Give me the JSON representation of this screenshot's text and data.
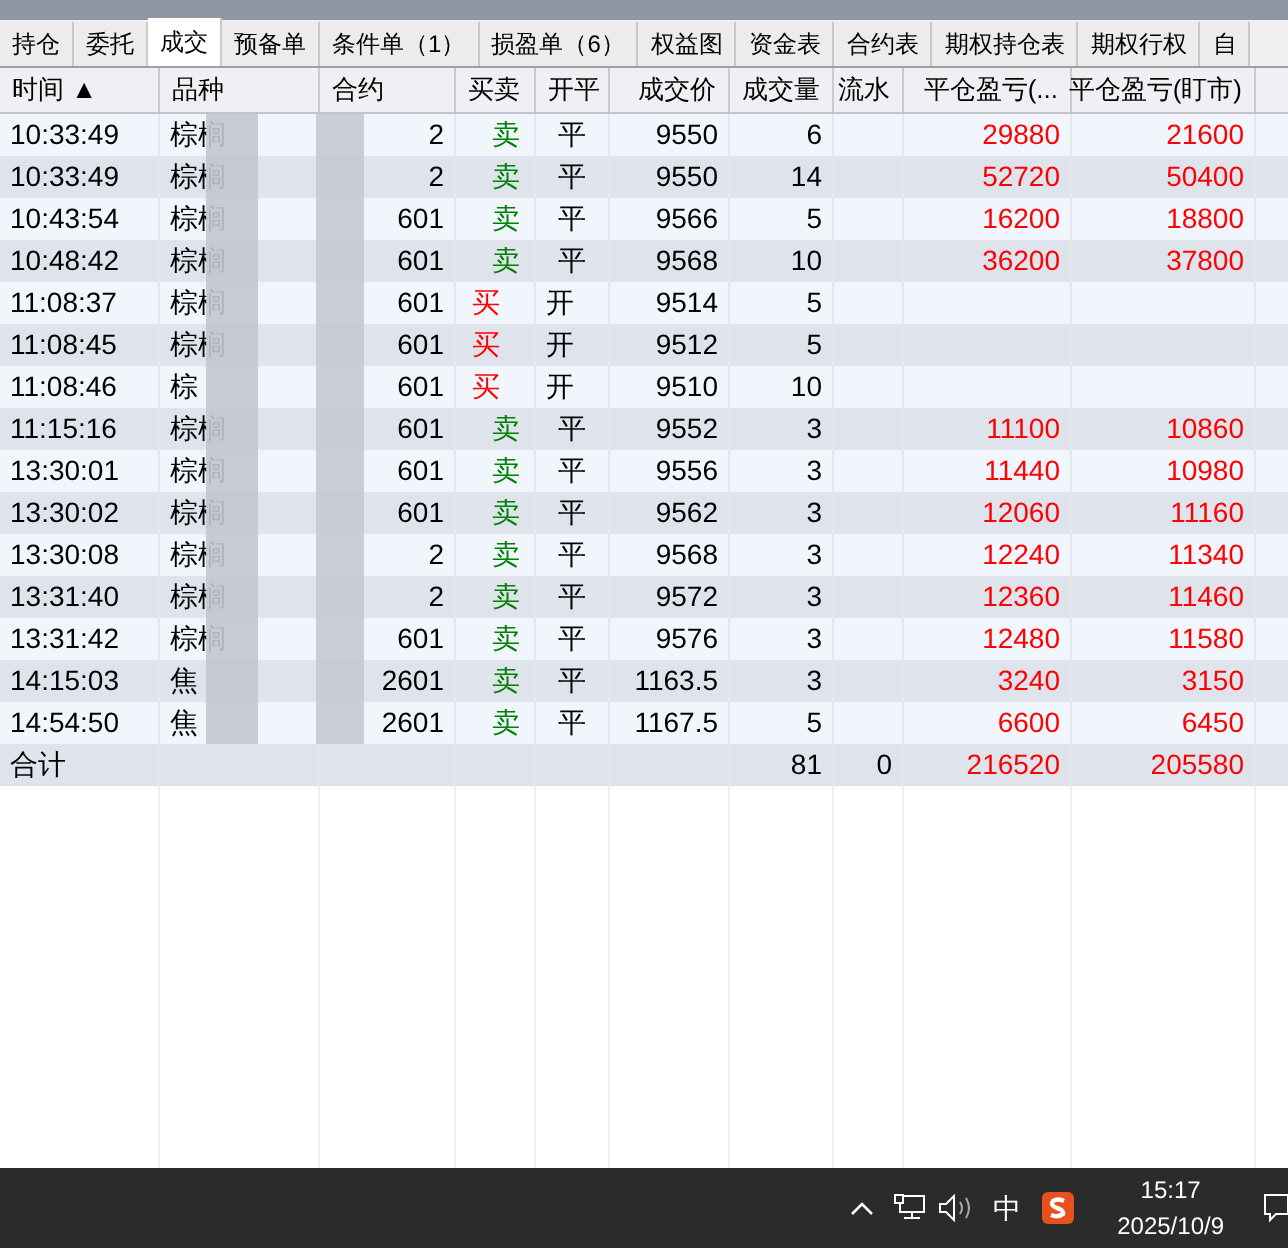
{
  "tabs": [
    {
      "label": "持仓",
      "selected": false
    },
    {
      "label": "委托",
      "selected": false
    },
    {
      "label": "成交",
      "selected": true
    },
    {
      "label": "预备单",
      "selected": false
    },
    {
      "label": "条件单（1）",
      "selected": false
    },
    {
      "label": "损盈单（6）",
      "selected": false
    },
    {
      "label": "权益图",
      "selected": false
    },
    {
      "label": "资金表",
      "selected": false
    },
    {
      "label": "合约表",
      "selected": false
    },
    {
      "label": "期权持仓表",
      "selected": false
    },
    {
      "label": "期权行权",
      "selected": false
    },
    {
      "label": "自",
      "selected": false
    }
  ],
  "table": {
    "columns": [
      "时间 ▲",
      "品种",
      "合约",
      "买卖",
      "开平",
      "成交价",
      "成交量",
      "流水",
      "平仓盈亏(...",
      "平仓盈亏(盯市)"
    ],
    "rows": [
      {
        "time": "10:33:49",
        "product": "棕榈",
        "contract": "2",
        "side": {
          "text": "卖",
          "kind": "sell"
        },
        "open_close": "平",
        "price": "9550",
        "qty": "6",
        "pnl_close": "29880",
        "pnl_mtm": "21600"
      },
      {
        "time": "10:33:49",
        "product": "棕榈",
        "contract": "2",
        "side": {
          "text": "卖",
          "kind": "sell"
        },
        "open_close": "平",
        "price": "9550",
        "qty": "14",
        "pnl_close": "52720",
        "pnl_mtm": "50400"
      },
      {
        "time": "10:43:54",
        "product": "棕榈",
        "contract": "601",
        "side": {
          "text": "卖",
          "kind": "sell"
        },
        "open_close": "平",
        "price": "9566",
        "qty": "5",
        "pnl_close": "16200",
        "pnl_mtm": "18800"
      },
      {
        "time": "10:48:42",
        "product": "棕榈",
        "contract": "601",
        "side": {
          "text": "卖",
          "kind": "sell"
        },
        "open_close": "平",
        "price": "9568",
        "qty": "10",
        "pnl_close": "36200",
        "pnl_mtm": "37800"
      },
      {
        "time": "11:08:37",
        "product": "棕榈",
        "contract": "601",
        "side": {
          "text": "买",
          "kind": "buy"
        },
        "open_close": "开",
        "price": "9514",
        "qty": "5"
      },
      {
        "time": "11:08:45",
        "product": "棕榈",
        "contract": "601",
        "side": {
          "text": "买",
          "kind": "buy"
        },
        "open_close": "开",
        "price": "9512",
        "qty": "5"
      },
      {
        "time": "11:08:46",
        "product": "棕",
        "contract": "601",
        "side": {
          "text": "买",
          "kind": "buy"
        },
        "open_close": "开",
        "price": "9510",
        "qty": "10"
      },
      {
        "time": "11:15:16",
        "product": "棕榈",
        "contract": "601",
        "side": {
          "text": "卖",
          "kind": "sell"
        },
        "open_close": "平",
        "price": "9552",
        "qty": "3",
        "pnl_close": "11100",
        "pnl_mtm": "10860"
      },
      {
        "time": "13:30:01",
        "product": "棕榈",
        "contract": "601",
        "side": {
          "text": "卖",
          "kind": "sell"
        },
        "open_close": "平",
        "price": "9556",
        "qty": "3",
        "pnl_close": "11440",
        "pnl_mtm": "10980"
      },
      {
        "time": "13:30:02",
        "product": "棕榈",
        "contract": "601",
        "side": {
          "text": "卖",
          "kind": "sell"
        },
        "open_close": "平",
        "price": "9562",
        "qty": "3",
        "pnl_close": "12060",
        "pnl_mtm": "11160"
      },
      {
        "time": "13:30:08",
        "product": "棕榈",
        "contract": "2",
        "side": {
          "text": "卖",
          "kind": "sell"
        },
        "open_close": "平",
        "price": "9568",
        "qty": "3",
        "pnl_close": "12240",
        "pnl_mtm": "11340"
      },
      {
        "time": "13:31:40",
        "product": "棕榈",
        "contract": "2",
        "side": {
          "text": "卖",
          "kind": "sell"
        },
        "open_close": "平",
        "price": "9572",
        "qty": "3",
        "pnl_close": "12360",
        "pnl_mtm": "11460"
      },
      {
        "time": "13:31:42",
        "product": "棕榈",
        "contract": "601",
        "side": {
          "text": "卖",
          "kind": "sell"
        },
        "open_close": "平",
        "price": "9576",
        "qty": "3",
        "pnl_close": "12480",
        "pnl_mtm": "11580"
      },
      {
        "time": "14:15:03",
        "product": "焦",
        "contract": "2601",
        "side": {
          "text": "卖",
          "kind": "sell"
        },
        "open_close": "平",
        "price": "1163.5",
        "qty": "3",
        "pnl_close": "3240",
        "pnl_mtm": "3150"
      },
      {
        "time": "14:54:50",
        "product": "焦",
        "contract": "2601",
        "side": {
          "text": "卖",
          "kind": "sell"
        },
        "open_close": "平",
        "price": "1167.5",
        "qty": "5",
        "pnl_close": "6600",
        "pnl_mtm": "6450"
      }
    ],
    "total": {
      "label": "合计",
      "qty": "81",
      "flow": "0",
      "pnl_close": "216520",
      "pnl_mtm": "205580"
    }
  },
  "taskbar": {
    "ime": "中",
    "time": "15:17",
    "date": "2025/10/9"
  }
}
